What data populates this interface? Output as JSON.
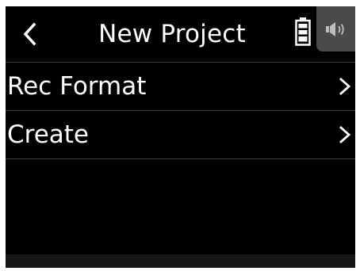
{
  "header": {
    "title": "New Project",
    "back_icon": "chevron-left-icon",
    "battery_icon": "battery-icon",
    "speaker_icon": "speaker-icon"
  },
  "menu": {
    "items": [
      {
        "label": "Rec Format",
        "icon": "chevron-right-icon"
      },
      {
        "label": "Create",
        "icon": "chevron-right-icon"
      }
    ]
  },
  "colors": {
    "background": "#000000",
    "text": "#ffffff",
    "divider": "#3c3c3c",
    "speaker_tab": "#4a4a4a",
    "icon_gray": "#bdbdbd"
  }
}
